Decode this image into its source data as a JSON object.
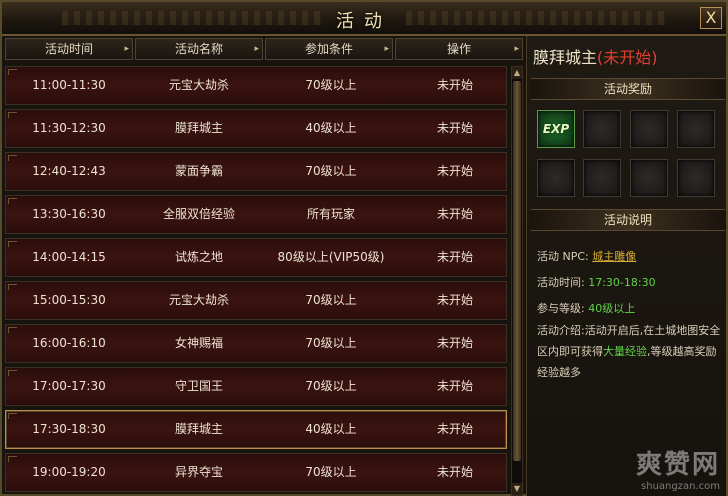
{
  "window": {
    "title": "活动",
    "close_label": "X"
  },
  "table": {
    "headers": [
      "活动时间",
      "活动名称",
      "参加条件",
      "操作"
    ],
    "rows": [
      {
        "time": "11:00-11:30",
        "name": "元宝大劫杀",
        "cond": "70级以上",
        "op": "未开始"
      },
      {
        "time": "11:30-12:30",
        "name": "膜拜城主",
        "cond": "40级以上",
        "op": "未开始"
      },
      {
        "time": "12:40-12:43",
        "name": "蒙面争霸",
        "cond": "70级以上",
        "op": "未开始"
      },
      {
        "time": "13:30-16:30",
        "name": "全服双倍经验",
        "cond": "所有玩家",
        "op": "未开始"
      },
      {
        "time": "14:00-14:15",
        "name": "试炼之地",
        "cond": "80级以上(VIP50级)",
        "op": "未开始"
      },
      {
        "time": "15:00-15:30",
        "name": "元宝大劫杀",
        "cond": "70级以上",
        "op": "未开始"
      },
      {
        "time": "16:00-16:10",
        "name": "女神赐福",
        "cond": "70级以上",
        "op": "未开始"
      },
      {
        "time": "17:00-17:30",
        "name": "守卫国王",
        "cond": "70级以上",
        "op": "未开始"
      },
      {
        "time": "17:30-18:30",
        "name": "膜拜城主",
        "cond": "40级以上",
        "op": "未开始"
      },
      {
        "time": "19:00-19:20",
        "name": "异界夺宝",
        "cond": "70级以上",
        "op": "未开始"
      }
    ],
    "selected_index": 8
  },
  "panel": {
    "event_name": "膜拜城主",
    "event_status": "(未开始)",
    "reward_header": "活动奖励",
    "reward_item_label": "EXP",
    "desc_header": "活动说明",
    "npc_label": "活动 NPC:",
    "npc_value": "城主雕像",
    "time_label": "活动时间:",
    "time_value": "17:30-18:30",
    "level_label": "参与等级:",
    "level_value": "40级以上",
    "intro_label": "活动介绍:",
    "intro_part1": "活动开启后,在土城地图安全区内即可获得",
    "intro_highlight": "大量经验",
    "intro_part2": ",等级越高奖励经验越多"
  },
  "watermark": {
    "text": "爽赞网",
    "url": "shuangzan.com"
  },
  "colors": {
    "status_red": "#e04030",
    "value_gold": "#d8ab34",
    "highlight_green": "#62d24a",
    "frame_gold": "#b9914c"
  }
}
